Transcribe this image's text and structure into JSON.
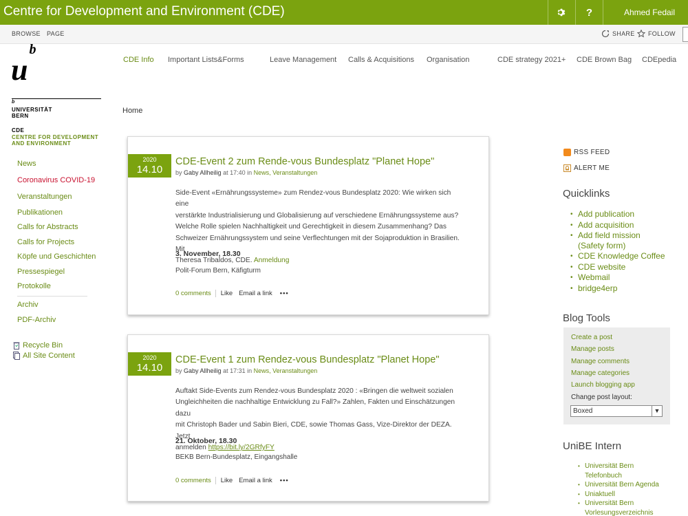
{
  "header": {
    "site_title": "Centre for Development and Environment (CDE)",
    "user_name": "Ahmed Fedail",
    "help_label": "?"
  },
  "ribbon": {
    "browse": "BROWSE",
    "page": "PAGE",
    "share": "SHARE",
    "follow": "FOLLOW"
  },
  "logo": {
    "mark": "u",
    "mark_sup": "b",
    "small_b": "b",
    "uni_line1": "UNIVERSITÄT",
    "uni_line2": "BERN",
    "cde_line1": "CDE",
    "cde_line2": "CENTRE FOR DEVELOPMENT",
    "cde_line3": "AND ENVIRONMENT"
  },
  "topnav": [
    "CDE Info",
    "Important Lists&Forms",
    "Leave Management",
    "Calls & Acquisitions",
    "Organisation",
    "CDE strategy 2021+",
    "CDE Brown Bag",
    "CDEpedia"
  ],
  "breadcrumb": "Home",
  "leftnav": [
    "News",
    "Coronavirus COVID-19",
    "Veranstaltungen",
    "Publikationen",
    "Calls for Abstracts",
    "Calls for Projects",
    "Köpfe und Geschichten",
    "Pressespiegel",
    "Protokolle",
    "Archiv",
    "PDF-Archiv"
  ],
  "leftutil": {
    "recycle": "Recycle Bin",
    "all_content": "All Site Content"
  },
  "posts": [
    {
      "year": "2020",
      "day": "14.10",
      "title": "CDE-Event 2 zum Rende-vous Bundesplatz \"Planet Hope\"",
      "by": "by",
      "author": "Gaby Allheilig",
      "at": "at 17:40 in",
      "categories": "News, Veranstaltungen",
      "body": [
        "Side-Event «Ernährungssysteme» zum Rendez-vous Bundesplatz 2020: Wie wirken sich eine",
        "verstärkte Industrialisierung und Globalisierung auf verschiedene Ernährungssysteme aus?",
        "Welche Rolle spielen Nachhaltigkeit und Gerechtigkeit in diesem Zusammenhang? Das",
        "Schweizer Ernährungssystem und seine Verflechtungen mit der Sojaproduktion in Brasilien. Mit",
        "Theresa Tribaldos, CDE."
      ],
      "link": "Anmeldung",
      "date_line": "3. November, 18.30",
      "venue": "Polit-Forum Bern, Käfigturm",
      "comments": "0 comments",
      "like": "Like",
      "email": "Email a link",
      "dots": "•••"
    },
    {
      "year": "2020",
      "day": "14.10",
      "title": "CDE-Event 1 zum Rendez-vous Bundesplatz \"Planet Hope\"",
      "by": "by",
      "author": "Gaby Allheilig",
      "at": "at 17:31 in",
      "categories": "News, Veranstaltungen",
      "body": [
        "Auftakt Side-Events zum Rendez-vous Bundesplatz 2020 : «Bringen die weltweit sozialen",
        "Ungleichheiten die nachhaltige Entwicklung zu Fall?» Zahlen, Fakten und Einschätzungen dazu",
        "mit Christoph Bader und Sabin Bieri, CDE, sowie Thomas Gass, Vize-Direktor der DEZA. Jetzt",
        "anmelden"
      ],
      "link": "https://bit.ly/2GRfyFY",
      "date_line": "21. Oktober, 18.30",
      "venue": "BEKB Bern-Bundesplatz, Eingangshalle",
      "comments": "0 comments",
      "like": "Like",
      "email": "Email a link",
      "dots": "•••"
    }
  ],
  "right": {
    "rss": "RSS FEED",
    "alert": "ALERT ME",
    "quicklinks_title": "Quicklinks",
    "quicklinks": [
      "Add publication",
      "Add acquisition",
      "Add field mission",
      "(Safety form)",
      "CDE Knowledge Coffee",
      "CDE website",
      "Webmail",
      "bridge4erp"
    ],
    "blogtools_title": "Blog Tools",
    "blogtools": [
      "Create a post",
      "Manage posts",
      "Manage comments",
      "Manage categories",
      "Launch blogging app"
    ],
    "layout_label": "Change post layout:",
    "layout_value": "Boxed",
    "unibe_title": "UniBE Intern",
    "unibe": [
      "Universität Bern",
      "Telefonbuch",
      "Universität Bern Agenda",
      "Uniaktuell",
      "Universität Bern",
      "Vorlesungsverzeichnis"
    ]
  }
}
